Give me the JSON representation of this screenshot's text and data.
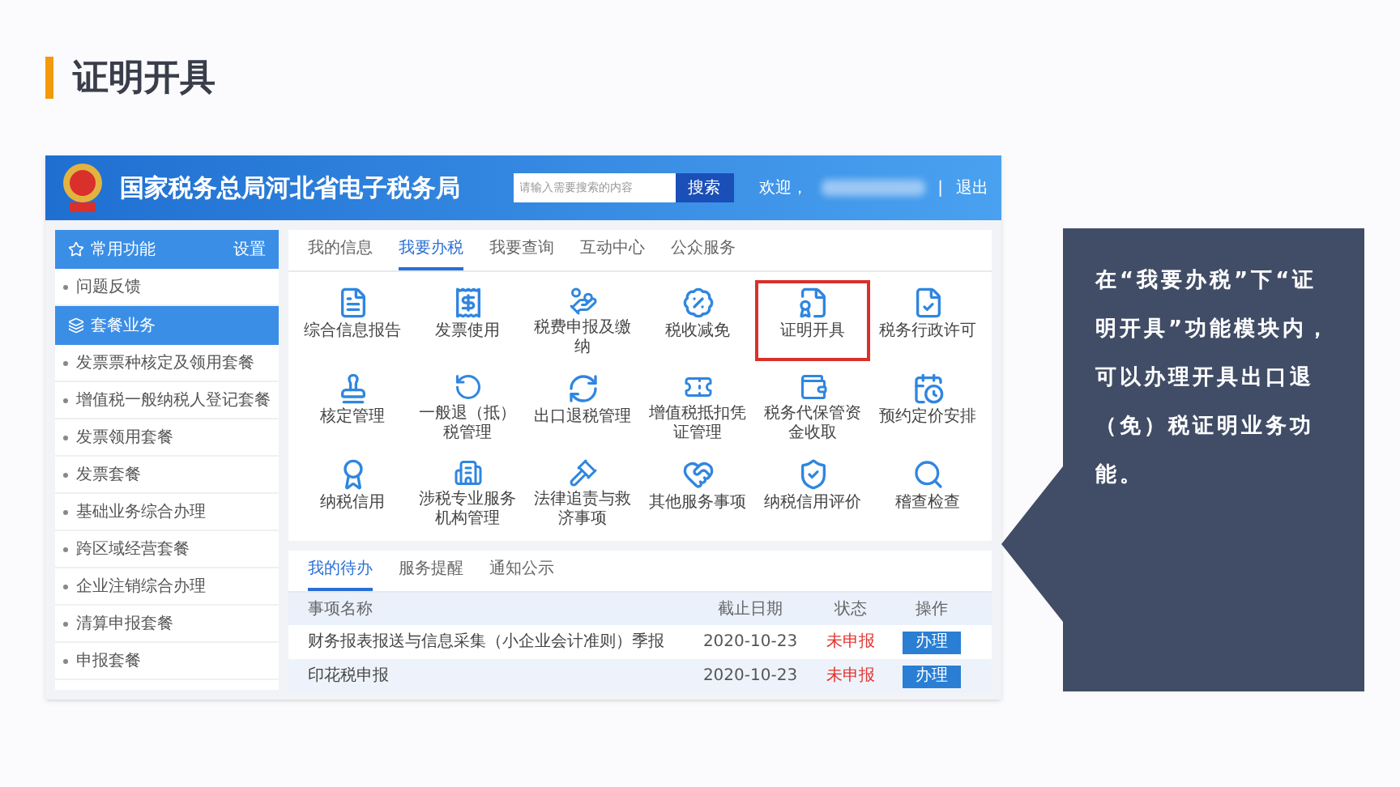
{
  "slide_title": "证明开具",
  "site": {
    "title": "国家税务总局河北省电子税务局",
    "search": {
      "placeholder": "请输入需要搜索的内容",
      "button": "搜索"
    },
    "welcome": "欢迎，",
    "separator": "|",
    "logout": "退出"
  },
  "sidebar": [
    {
      "kind": "header",
      "label": "常用功能",
      "action": "设置"
    },
    {
      "kind": "item",
      "label": "问题反馈"
    },
    {
      "kind": "header",
      "label": "套餐业务"
    },
    {
      "kind": "item",
      "label": "发票票种核定及领用套餐"
    },
    {
      "kind": "item",
      "label": "增值税一般纳税人登记套餐"
    },
    {
      "kind": "item",
      "label": "发票领用套餐"
    },
    {
      "kind": "item",
      "label": "发票套餐"
    },
    {
      "kind": "item",
      "label": "基础业务综合办理"
    },
    {
      "kind": "item",
      "label": "跨区域经营套餐"
    },
    {
      "kind": "item",
      "label": "企业注销综合办理"
    },
    {
      "kind": "item",
      "label": "清算申报套餐"
    },
    {
      "kind": "item",
      "label": "申报套餐"
    }
  ],
  "tabs": [
    {
      "label": "我的信息",
      "selected": false
    },
    {
      "label": "我要办税",
      "selected": true
    },
    {
      "label": "我要查询",
      "selected": false
    },
    {
      "label": "互动中心",
      "selected": false
    },
    {
      "label": "公众服务",
      "selected": false
    }
  ],
  "modules": [
    {
      "label": "综合信息报告",
      "highlighted": false
    },
    {
      "label": "发票使用",
      "highlighted": false
    },
    {
      "label": "税费申报及缴纳",
      "highlighted": false
    },
    {
      "label": "税收减免",
      "highlighted": false
    },
    {
      "label": "证明开具",
      "highlighted": true
    },
    {
      "label": "税务行政许可",
      "highlighted": false
    },
    {
      "label": "核定管理",
      "highlighted": false
    },
    {
      "label": "一般退（抵）税管理",
      "highlighted": false
    },
    {
      "label": "出口退税管理",
      "highlighted": false
    },
    {
      "label": "增值税抵扣凭证管理",
      "highlighted": false
    },
    {
      "label": "税务代保管资金收取",
      "highlighted": false
    },
    {
      "label": "预约定价安排",
      "highlighted": false
    },
    {
      "label": "纳税信用",
      "highlighted": false
    },
    {
      "label": "涉税专业服务机构管理",
      "highlighted": false
    },
    {
      "label": "法律追责与救济事项",
      "highlighted": false
    },
    {
      "label": "其他服务事项",
      "highlighted": false
    },
    {
      "label": "纳税信用评价",
      "highlighted": false
    },
    {
      "label": "稽查检查",
      "highlighted": false
    }
  ],
  "todo": {
    "tabs": [
      {
        "label": "我的待办",
        "selected": true
      },
      {
        "label": "服务提醒",
        "selected": false
      },
      {
        "label": "通知公示",
        "selected": false
      }
    ],
    "columns": [
      "事项名称",
      "截止日期",
      "状态",
      "操作"
    ],
    "rows": [
      {
        "name": "财务报表报送与信息采集（小企业会计准则）季报",
        "deadline": "2020-10-23",
        "status": "未申报",
        "action": "办理"
      },
      {
        "name": "印花税申报",
        "deadline": "2020-10-23",
        "status": "未申报",
        "action": "办理"
      }
    ]
  },
  "callout": "在“我要办税”下“证明开具”功能模块内，可以办理开具出口退（免）税证明业务功能。"
}
